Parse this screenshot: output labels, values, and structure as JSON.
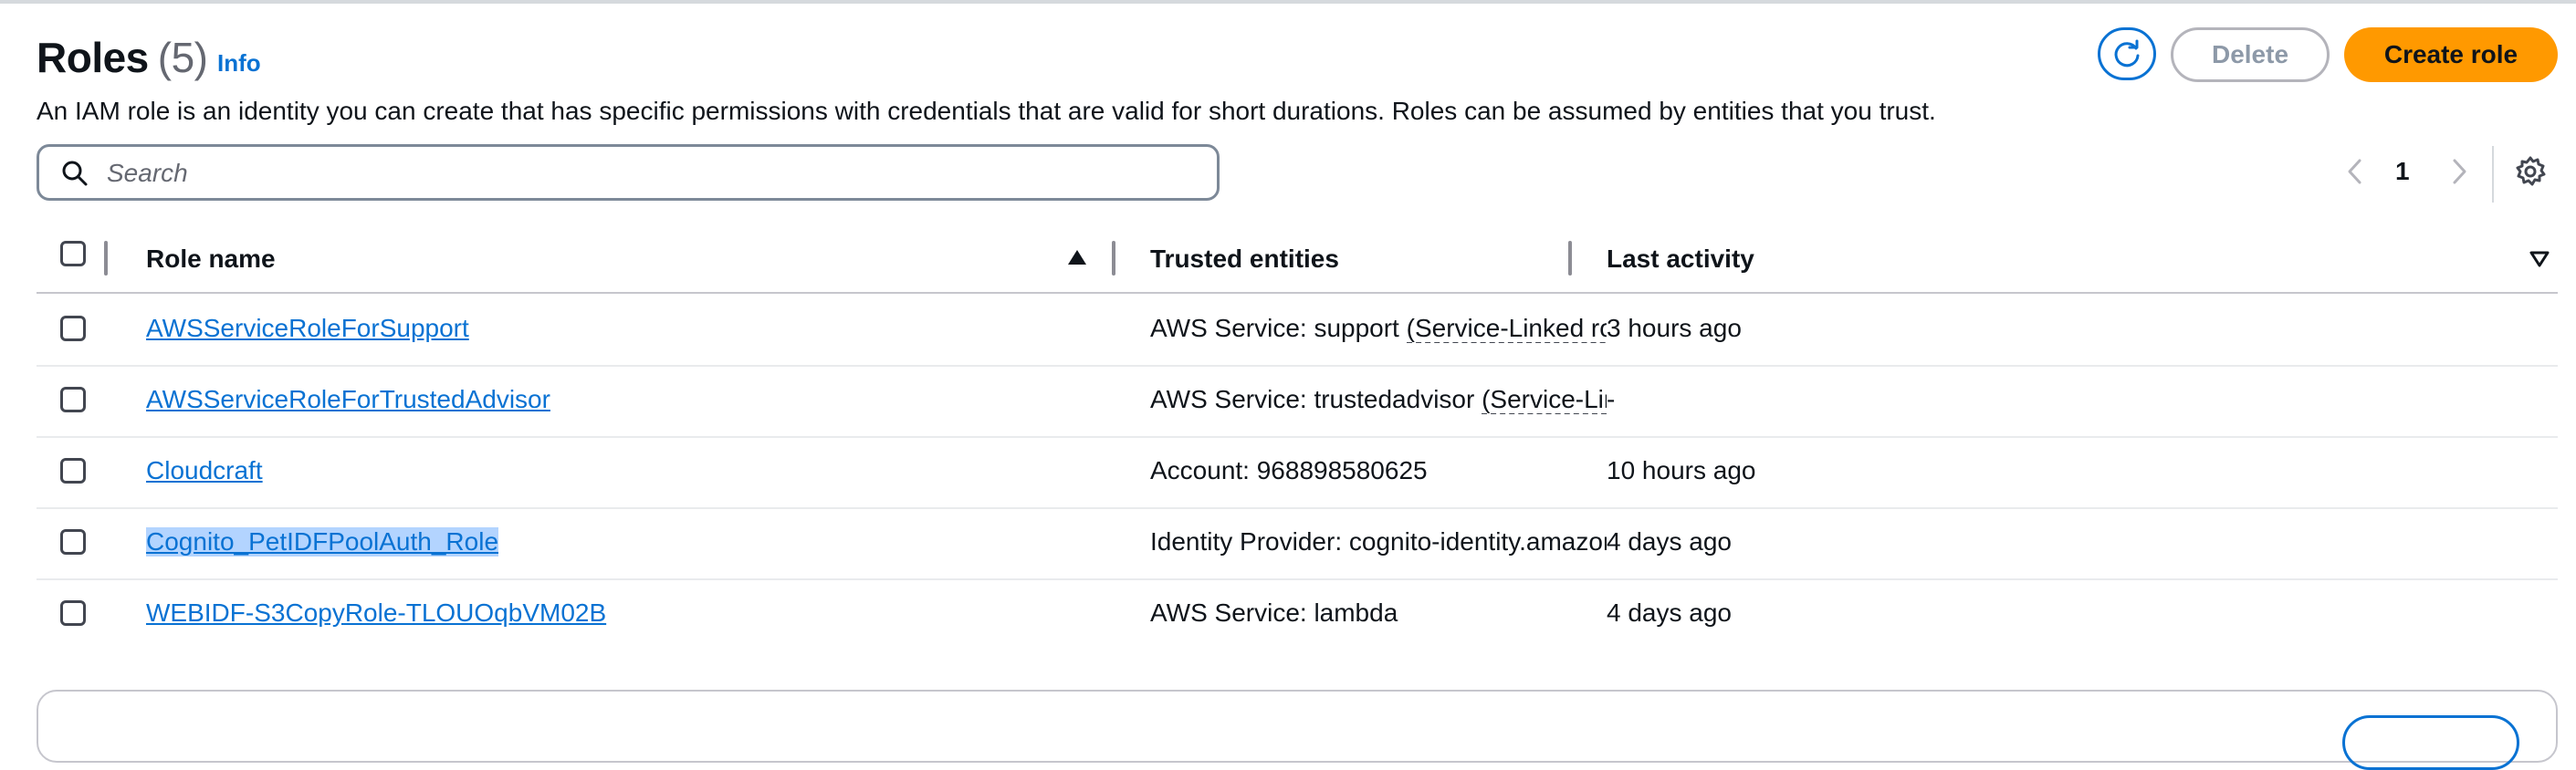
{
  "header": {
    "title": "Roles",
    "count": "(5)",
    "info_label": "Info",
    "description": "An IAM role is an identity you can create that has specific permissions with credentials that are valid for short durations. Roles can be assumed by entities that you trust."
  },
  "actions": {
    "refresh_icon": "refresh-icon",
    "delete_label": "Delete",
    "create_label": "Create role"
  },
  "search": {
    "placeholder": "Search",
    "value": ""
  },
  "pagination": {
    "current_page": "1"
  },
  "table": {
    "columns": [
      "Role name",
      "Trusted entities",
      "Last activity"
    ],
    "sort": {
      "column": "Role name",
      "direction": "ascending"
    },
    "rows": [
      {
        "name": "AWSServiceRoleForSupport",
        "trusted_prefix": "AWS Service: support ",
        "trusted_link": "(Service-Linked role)",
        "activity": "3 hours ago",
        "selected_text": false
      },
      {
        "name": "AWSServiceRoleForTrustedAdvisor",
        "trusted_prefix": "AWS Service: trustedadvisor ",
        "trusted_link": "(Service-Linked role)",
        "activity": "-",
        "selected_text": false
      },
      {
        "name": "Cloudcraft",
        "trusted_prefix": "Account: 968898580625",
        "trusted_link": "",
        "activity": "10 hours ago",
        "selected_text": false
      },
      {
        "name": "Cognito_PetIDFPoolAuth_Role",
        "trusted_prefix": "Identity Provider: cognito-identity.amazonaws.com",
        "trusted_link": "",
        "activity": "4 days ago",
        "selected_text": true
      },
      {
        "name": "WEBIDF-S3CopyRole-TLOUOqbVM02B",
        "trusted_prefix": "AWS Service: lambda",
        "trusted_link": "",
        "activity": "4 days ago",
        "selected_text": false
      }
    ]
  },
  "colors": {
    "accent_blue": "#0972d3",
    "primary_orange": "#ff9900",
    "disabled_gray": "#8d99a8",
    "text": "#0f141a"
  }
}
